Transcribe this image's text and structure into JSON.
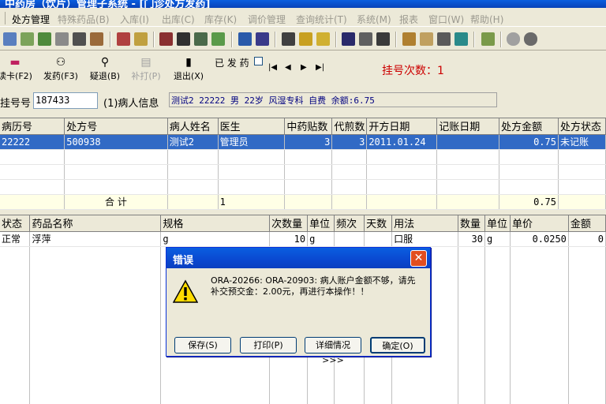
{
  "window": {
    "title": "中药房（饮片）管理子系统 - [门诊处方发药]"
  },
  "menu": [
    {
      "label": "处方管理",
      "grey": false
    },
    {
      "label": "特殊药品(B)",
      "grey": true
    },
    {
      "label": "入库(I)",
      "grey": true
    },
    {
      "label": "出库(C)",
      "grey": true
    },
    {
      "label": "库存(K)",
      "grey": true
    },
    {
      "label": "调价管理",
      "grey": true
    },
    {
      "label": "查询统计(T)",
      "grey": true
    },
    {
      "label": "系统(M)",
      "grey": true
    },
    {
      "label": "报表",
      "grey": true
    },
    {
      "label": "窗口(W)",
      "grey": true
    },
    {
      "label": "帮助(H)",
      "grey": true
    }
  ],
  "toolbar2": {
    "read_card": "读卡(F2)",
    "dispense": "发药(F3)",
    "query": "疑退(B)",
    "reprint": "补打(P)",
    "exit": "退出(X)",
    "dispensed_label": "已 发 药",
    "nav": [
      "|◀",
      "◀",
      "▶",
      "▶|"
    ],
    "reg_count": "挂号次数：1"
  },
  "patient": {
    "reg_label": "挂号号",
    "reg_value": "187433",
    "info_label": "(1)病人信息",
    "info_value": "测试2 22222 男 22岁 风湿专科 自费 余额:6.75"
  },
  "prescriptions": {
    "columns": [
      "病历号",
      "处方号",
      "病人姓名",
      "医生",
      "中药贴数",
      "代煎数",
      "开方日期",
      "记账日期",
      "处方金额",
      "处方状态"
    ],
    "rows": [
      [
        "22222",
        "500938",
        "测试2",
        "管理员",
        "3",
        "3",
        "2011.01.24",
        "",
        "0.75",
        "未记账"
      ]
    ],
    "total": {
      "label": "合  计",
      "doctor": "1",
      "amount": "0.75"
    }
  },
  "drugs": {
    "columns": [
      "状态",
      "药品名称",
      "规格",
      "次数量",
      "单位",
      "频次",
      "天数",
      "用法",
      "数量",
      "单位",
      "单价",
      "金额"
    ],
    "rows": [
      [
        "正常",
        "浮萍",
        "g",
        "10",
        "g",
        "",
        "",
        "口服",
        "30",
        "g",
        "0.0250",
        "0"
      ]
    ]
  },
  "dialog": {
    "title": "错误",
    "message": "ORA-20266: ORA-20903: 病人账户金额不够，请先补交预交金：2.00元，再进行本操作！！",
    "buttons": {
      "save": "保存(S)",
      "print": "打印(P)",
      "details": "详细情况>>>",
      "ok": "确定(O)"
    }
  },
  "colors": {
    "selection": "#316ac5",
    "accent_red": "#cc0000",
    "title_blue": "#0a5ee0"
  }
}
